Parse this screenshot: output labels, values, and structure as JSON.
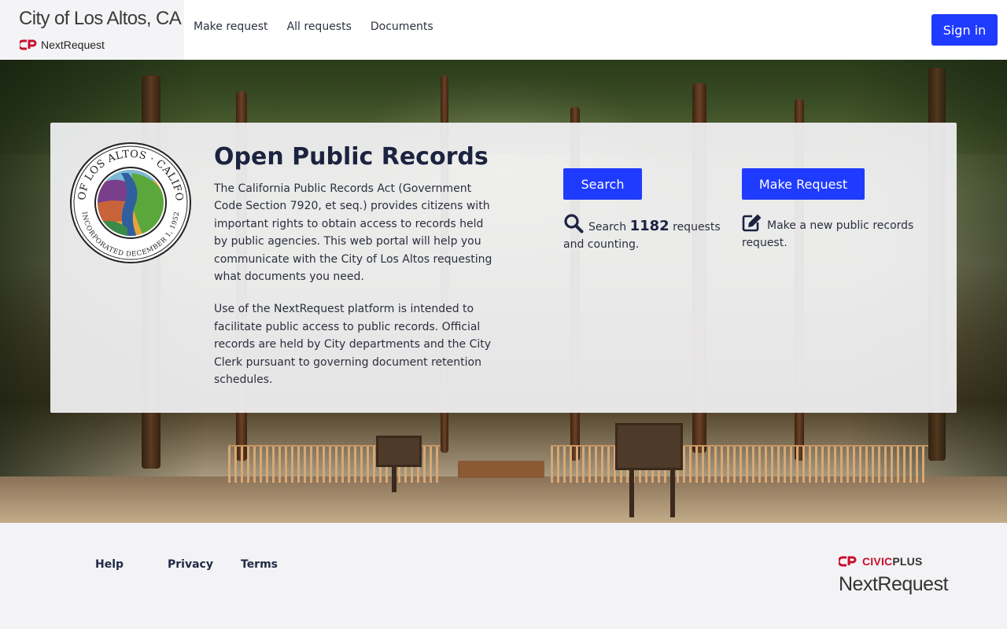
{
  "header": {
    "city_name": "City of Los Altos, CA",
    "brand_logo_text": "NextRequest",
    "nav": [
      {
        "label": "Make request"
      },
      {
        "label": "All requests"
      },
      {
        "label": "Documents"
      }
    ],
    "sign_in_label": "Sign in"
  },
  "hero": {
    "seal": {
      "top_text": "CITY OF LOS ALTOS · CALIFORNIA",
      "bottom_text": "INCORPORATED DECEMBER 1, 1952"
    },
    "title": "Open Public Records",
    "paragraphs": [
      "The California Public Records Act (Government Code Section 7920, et seq.) provides citizens with important rights to obtain access to records held by public agencies. This web portal will help you communicate with the City of Los Altos requesting what documents you need.",
      "Use of the NextRequest platform is intended to facilitate public access to public records. Official records are held by City departments and the City Clerk pursuant to governing document retention schedules."
    ],
    "search": {
      "button_label": "Search",
      "icon": "search-icon",
      "text_before": "Search ",
      "count": "1182",
      "text_after": " requests and counting."
    },
    "make_request": {
      "button_label": "Make Request",
      "icon": "edit-icon",
      "text": "Make a new public records request."
    }
  },
  "footer": {
    "links": [
      {
        "label": "Help"
      },
      {
        "label": "Privacy"
      },
      {
        "label": "Terms"
      }
    ],
    "civic_brand_red": "CIVIC",
    "civic_brand_dark": "PLUS",
    "product_name": "NextRequest"
  },
  "colors": {
    "primary": "#1f3bff",
    "civic_red": "#c8102e",
    "heading": "#1c2340"
  }
}
